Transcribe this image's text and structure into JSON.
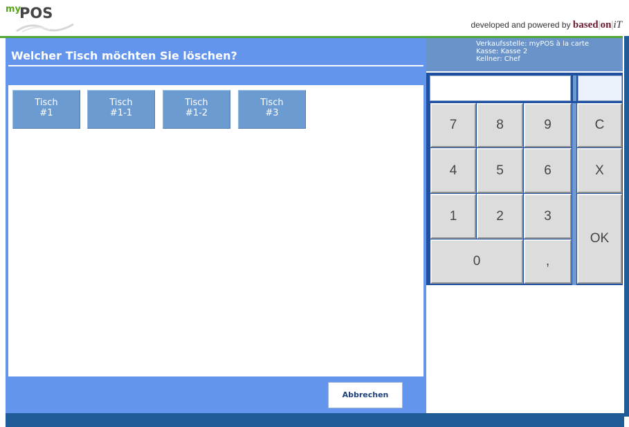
{
  "header": {
    "logo_my": "my",
    "logo_pos": "POS",
    "tagline_prefix": "developed and powered by",
    "brand_based": "based",
    "brand_on": "on",
    "brand_it": "iT"
  },
  "dialog": {
    "title": "Welcher Tisch möchten Sie löschen?",
    "tables": [
      {
        "line1": "Tisch",
        "line2": "#1"
      },
      {
        "line1": "Tisch",
        "line2": "#1-1"
      },
      {
        "line1": "Tisch",
        "line2": "#1-2"
      },
      {
        "line1": "Tisch",
        "line2": "#3"
      }
    ],
    "cancel_label": "Abbrechen"
  },
  "info": {
    "verkaufsstelle": "Verkaufsstelle: myPOS à la carte",
    "kasse": "Kasse: Kasse 2",
    "kellner": "Kellner: Chef"
  },
  "keypad": {
    "display_value": "",
    "display_small_value": "",
    "keys": {
      "k7": "7",
      "k8": "8",
      "k9": "9",
      "clear": "C",
      "k4": "4",
      "k5": "5",
      "k6": "6",
      "cancel": "X",
      "k1": "1",
      "k2": "2",
      "k3": "3",
      "ok": "OK",
      "k0": "0",
      "comma": ","
    }
  },
  "colors": {
    "panel_blue": "#6495ed",
    "table_button": "#6c9bd2",
    "keypad_frame": "#1f4fa0",
    "brand_green": "#4fa833",
    "bottom_bar": "#1f5c97"
  }
}
